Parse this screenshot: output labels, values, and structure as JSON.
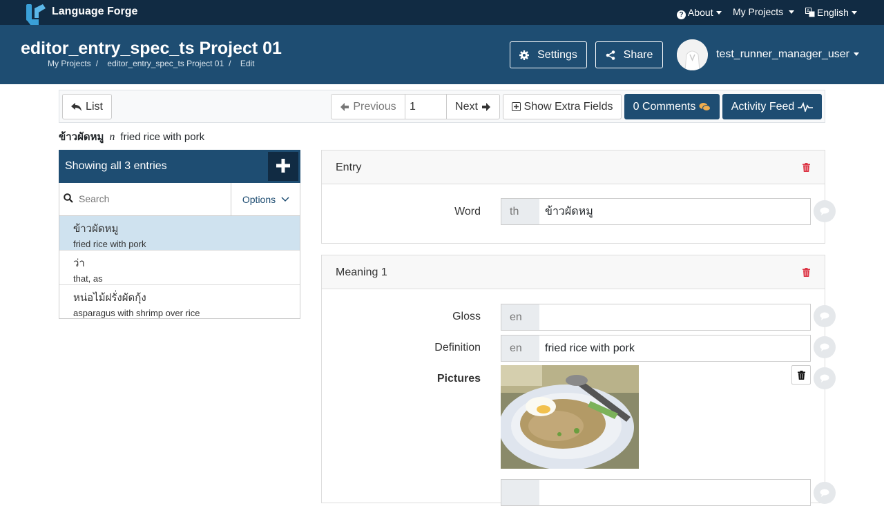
{
  "navbar": {
    "brand": "Language Forge",
    "about": "About",
    "my_projects": "My Projects",
    "language": "English"
  },
  "header": {
    "project_title": "editor_entry_spec_ts Project 01",
    "breadcrumb": [
      "My Projects",
      "editor_entry_spec_ts Project 01",
      "Edit"
    ],
    "settings_label": "Settings",
    "share_label": "Share",
    "username": "test_runner_manager_user"
  },
  "toolbar": {
    "list_label": "List",
    "previous_label": "Previous",
    "page_value": "1",
    "next_label": "Next",
    "extra_fields_label": "Show Extra Fields",
    "comments_label": "0 Comments",
    "activity_label": "Activity Feed"
  },
  "summary": {
    "lexeme": "ข้าวผัดหมู",
    "pos": "n",
    "gloss": "fried rice with pork"
  },
  "entry_list": {
    "heading": "Showing all 3 entries",
    "search_placeholder": "Search",
    "options_label": "Options",
    "items": [
      {
        "word": "ข้าวผัดหมู",
        "gloss": "fried rice with pork"
      },
      {
        "word": "ว่า",
        "gloss": "that, as"
      },
      {
        "word": "หน่อไม้ฝรั่งผัดกุ้ง",
        "gloss": "asparagus with shrimp over rice"
      }
    ]
  },
  "entry_panel": {
    "title": "Entry",
    "word_label": "Word",
    "word_lang": "th",
    "word_value": "ข้าวผัดหมู"
  },
  "meaning_panel": {
    "title": "Meaning 1",
    "gloss_label": "Gloss",
    "gloss_lang": "en",
    "gloss_value": "",
    "definition_label": "Definition",
    "definition_lang": "en",
    "definition_value": "fried rice with pork",
    "pictures_label": "Pictures"
  },
  "colors": {
    "navbar": "#112b43",
    "header": "#1e4d72",
    "active_item": "#cfe2ef",
    "trash_red": "#dc3545"
  },
  "icons": [
    "logo",
    "question-circle-icon",
    "translate-icon",
    "gear-icon",
    "share-icon",
    "reply-icon",
    "arrow-left-icon",
    "arrow-right-icon",
    "plus-square-icon",
    "comments-icon",
    "pulse-icon",
    "plus-icon",
    "search-icon",
    "chevron-down-icon",
    "trash-icon",
    "comment-icon"
  ]
}
